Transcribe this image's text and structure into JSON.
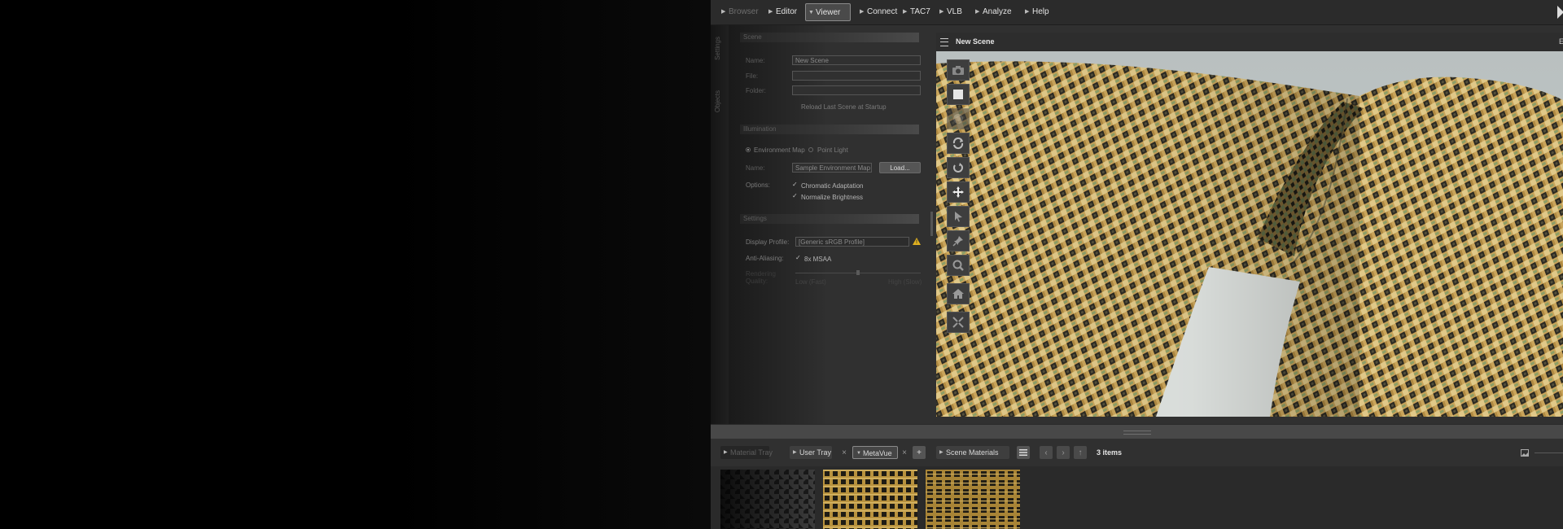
{
  "nav": {
    "items": [
      {
        "label": "Browser"
      },
      {
        "label": "Editor"
      },
      {
        "label": "Viewer"
      },
      {
        "label": "Connect"
      },
      {
        "label": "TAC7"
      },
      {
        "label": "VLB"
      },
      {
        "label": "Analyze"
      },
      {
        "label": "Help"
      }
    ]
  },
  "side_tabs": [
    "Settings",
    "Objects"
  ],
  "scene": {
    "section_title": "Scene",
    "name_label": "Name:",
    "name_value": "New Scene",
    "file_label": "File:",
    "file_value": "",
    "folder_label": "Folder:",
    "folder_value": "",
    "reload_label": "Reload Last Scene at Startup"
  },
  "illumination": {
    "section_title": "Illumination",
    "env_map_label": "Environment Map",
    "point_light_label": "Point Light",
    "name_label": "Name:",
    "name_value": "Sample Environment Map",
    "load_button": "Load...",
    "options_label": "Options:",
    "chromatic_label": "Chromatic Adaptation",
    "normalize_label": "Normalize Brightness"
  },
  "settings": {
    "section_title": "Settings",
    "display_profile_label": "Display Profile:",
    "display_profile_value": "[Generic sRGB Profile]",
    "anti_aliasing_label": "Anti-Aliasing:",
    "msaa_label": "8x MSAA",
    "quality_label_1": "Rendering",
    "quality_label_2": "Quality:",
    "quality_low": "Low (Fast)",
    "quality_high": "High (Slow)",
    "quality_level": 0.5
  },
  "viewer": {
    "title": "New Scene",
    "right_edge_label": "E",
    "tools": [
      "camera-icon",
      "square-icon",
      "sphere-icon",
      "rotate-icon",
      "rotate-reset-icon",
      "move-icon",
      "pointer-icon",
      "pin-icon",
      "zoom-icon",
      "home-icon",
      "fit-icon"
    ]
  },
  "tray": {
    "tabs": [
      {
        "label": "Material Tray"
      },
      {
        "label": "User Tray"
      },
      {
        "label": "MetaVue"
      },
      {
        "label": "Scene Materials"
      }
    ],
    "add_label": "+",
    "close_label": "×",
    "items_count": "3 items"
  },
  "colors": {
    "accent_warning": "#e0b020",
    "fabric_base": "#c9a45a",
    "fabric_dark": "#2c2a22",
    "fabric_green": "#8c9e66"
  }
}
